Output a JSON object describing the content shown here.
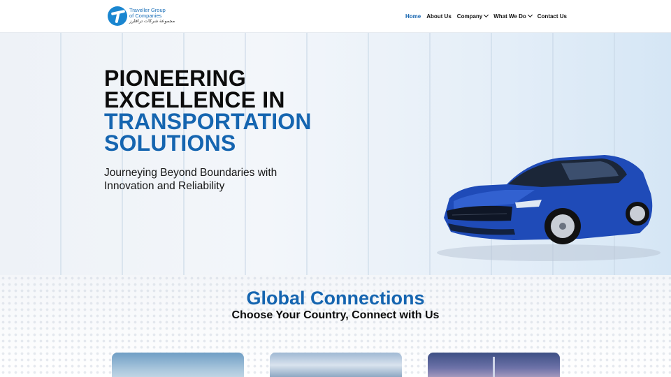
{
  "brand": {
    "name_line1": "Traveller Group",
    "name_line2": "of Companies",
    "name_arabic": "مجموعة شركات ترافلرز"
  },
  "nav": {
    "items": [
      {
        "label": "Home",
        "active": true,
        "has_dropdown": false
      },
      {
        "label": "About Us",
        "active": false,
        "has_dropdown": false
      },
      {
        "label": "Company",
        "active": false,
        "has_dropdown": true
      },
      {
        "label": "What We Do",
        "active": false,
        "has_dropdown": true
      },
      {
        "label": "Contact Us",
        "active": false,
        "has_dropdown": false
      }
    ]
  },
  "hero": {
    "title_line1": "PIONEERING",
    "title_line2": "EXCELLENCE IN",
    "title_line3": "TRANSPORTATION",
    "title_line4": "SOLUTIONS",
    "subtitle": "Journeying Beyond Boundaries with Innovation and Reliability",
    "image": "blue-sports-car"
  },
  "global": {
    "title": "Global Connections",
    "subtitle": "Choose Your Country, Connect with Us",
    "cards": [
      {
        "image": "sky-landscape"
      },
      {
        "image": "coastal-clouds"
      },
      {
        "image": "city-skyline-tower"
      }
    ]
  },
  "colors": {
    "accent": "#1565b0",
    "text": "#0c0c0c",
    "car": "#1f4bb8"
  }
}
